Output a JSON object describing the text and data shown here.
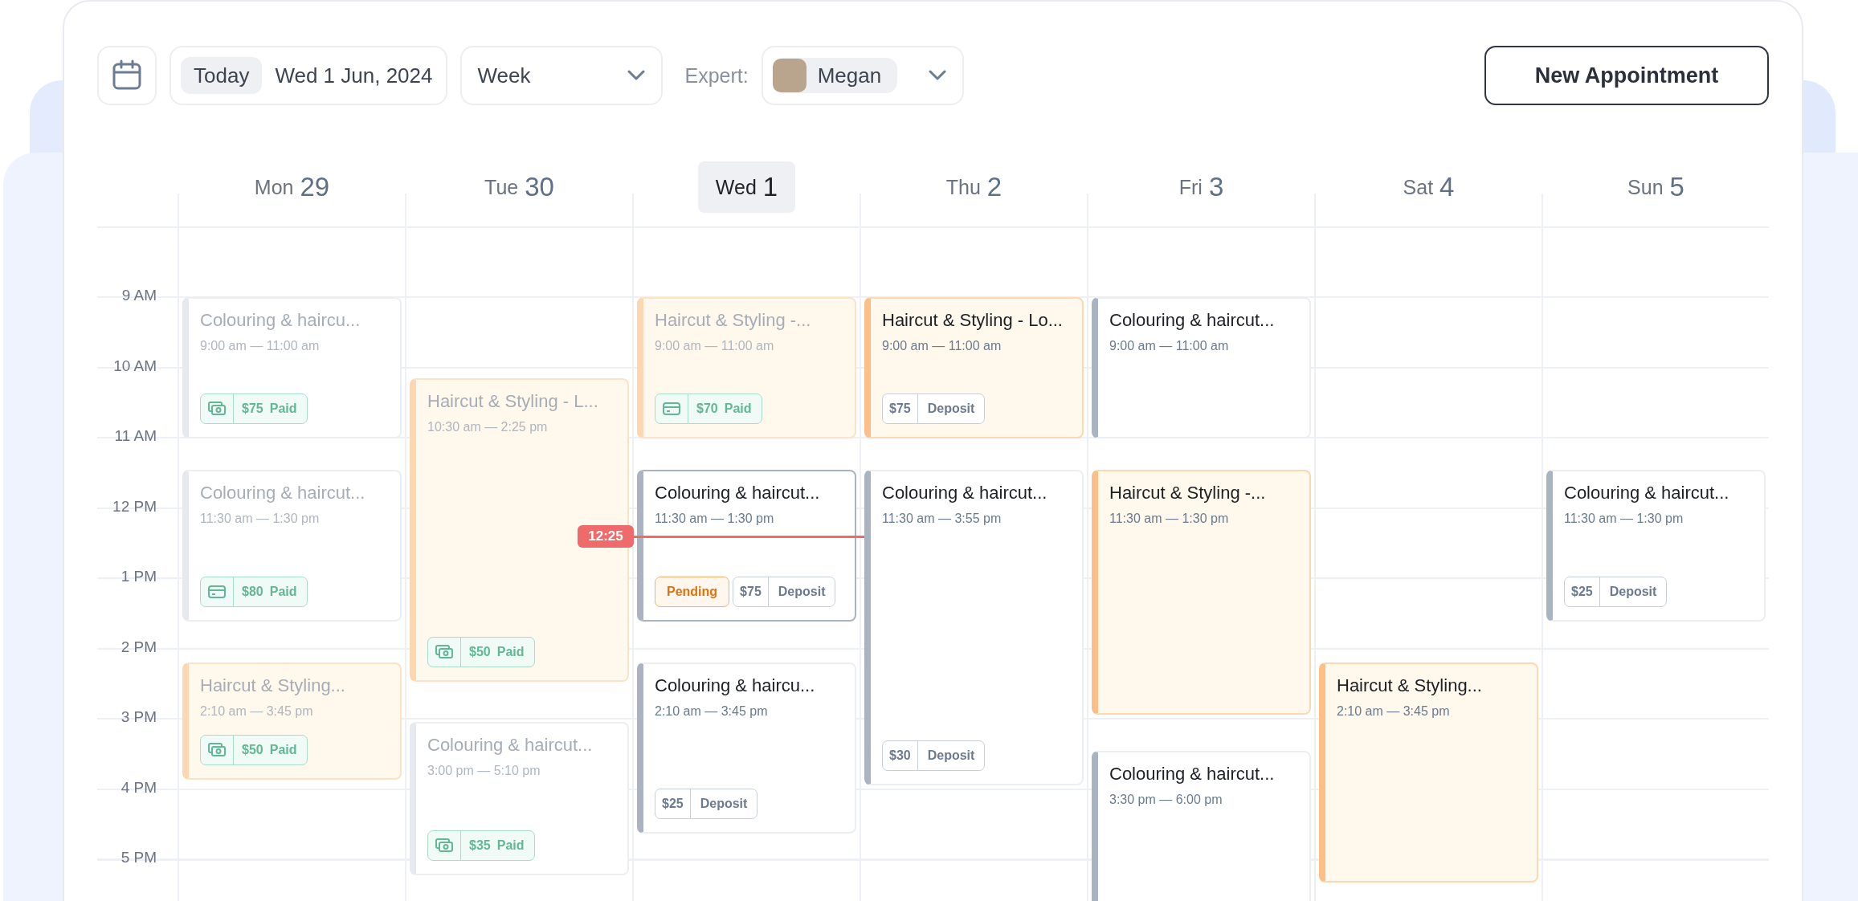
{
  "toolbar": {
    "today_button": "Today",
    "date": "Wed 1 Jun, 2024",
    "view_select": {
      "value": "Week"
    },
    "expert_label": "Expert:",
    "expert_select": {
      "value": "Megan"
    },
    "new_button": "New Appointment"
  },
  "hours": [
    "9 AM",
    "10 AM",
    "11 AM",
    "12 PM",
    "1 PM",
    "2 PM",
    "3 PM",
    "4 PM",
    "5 PM"
  ],
  "days": [
    {
      "weekday": "Mon",
      "date": "29",
      "selected": false,
      "events": [
        {
          "title": "Colouring & haircu...",
          "time": "9:00 am — 11:00 am",
          "kind": "plain",
          "past": true,
          "selected": false,
          "badges": [
            {
              "kind": "paid_cash",
              "amount": "$75",
              "status": "Paid"
            }
          ]
        },
        {
          "title": "Colouring & haircut...",
          "time": "11:30 am — 1:30 pm",
          "kind": "plain",
          "past": true,
          "selected": false,
          "badges": [
            {
              "kind": "paid_card",
              "amount": "$80",
              "status": "Paid"
            }
          ]
        },
        {
          "title": "Haircut & Styling...",
          "time": "2:10 am — 3:45 pm",
          "kind": "warm",
          "past": true,
          "selected": false,
          "badges": [
            {
              "kind": "paid_cash",
              "amount": "$50",
              "status": "Paid"
            }
          ]
        }
      ]
    },
    {
      "weekday": "Tue",
      "date": "30",
      "selected": false,
      "events": [
        {
          "title": "Haircut & Styling - L...",
          "time": "10:30 am — 2:25 pm",
          "kind": "warm",
          "past": true,
          "selected": false,
          "badges": [
            {
              "kind": "paid_cash",
              "amount": "$50",
              "status": "Paid"
            }
          ]
        },
        {
          "title": "Colouring & haircut...",
          "time": "3:00 pm — 5:10 pm",
          "kind": "plain",
          "past": true,
          "selected": false,
          "badges": [
            {
              "kind": "paid_cash",
              "amount": "$35",
              "status": "Paid"
            }
          ]
        }
      ]
    },
    {
      "weekday": "Wed",
      "date": "1",
      "selected": true,
      "now": "12:25",
      "events": [
        {
          "title": "Haircut & Styling -...",
          "time": "9:00 am — 11:00 am",
          "kind": "warm",
          "past": true,
          "selected": false,
          "badges": [
            {
              "kind": "paid_card",
              "amount": "$70",
              "status": "Paid"
            }
          ]
        },
        {
          "title": "Colouring & haircut...",
          "time": "11:30 am — 1:30 pm",
          "kind": "plain",
          "past": false,
          "selected": true,
          "badges": [
            {
              "kind": "pending",
              "label": "Pending"
            },
            {
              "kind": "deposit",
              "amount": "$75",
              "status": "Deposit"
            }
          ]
        },
        {
          "title": "Colouring & haircu...",
          "time": "2:10 am — 3:45 pm",
          "kind": "plain",
          "past": false,
          "selected": false,
          "badges": [
            {
              "kind": "deposit",
              "amount": "$25",
              "status": "Deposit"
            }
          ]
        }
      ]
    },
    {
      "weekday": "Thu",
      "date": "2",
      "selected": false,
      "events": [
        {
          "title": "Haircut & Styling - Lo...",
          "time": "9:00 am — 11:00 am",
          "kind": "warm",
          "past": false,
          "selected": false,
          "badges": [
            {
              "kind": "deposit",
              "amount": "$75",
              "status": "Deposit"
            }
          ]
        },
        {
          "title": "Colouring & haircut...",
          "time": "11:30 am — 3:55 pm",
          "kind": "plain",
          "past": false,
          "selected": false,
          "badges": [
            {
              "kind": "deposit",
              "amount": "$30",
              "status": "Deposit"
            }
          ]
        }
      ]
    },
    {
      "weekday": "Fri",
      "date": "3",
      "selected": false,
      "events": [
        {
          "title": "Colouring & haircut...",
          "time": "9:00 am — 11:00 am",
          "kind": "plain",
          "past": false,
          "selected": false
        },
        {
          "title": "Haircut & Styling -...",
          "time": "11:30 am — 1:30 pm",
          "kind": "warm",
          "past": false,
          "selected": false
        },
        {
          "title": "Colouring & haircut...",
          "time": "3:30 pm — 6:00 pm",
          "kind": "plain",
          "past": false,
          "selected": false
        }
      ]
    },
    {
      "weekday": "Sat",
      "date": "4",
      "selected": false,
      "events": [
        {
          "title": "Haircut & Styling...",
          "time": "2:10 am — 3:45 pm",
          "kind": "warm",
          "past": false,
          "selected": false
        }
      ]
    },
    {
      "weekday": "Sun",
      "date": "5",
      "selected": false,
      "events": [
        {
          "title": "Colouring & haircut...",
          "time": "11:30 am — 1:30 pm",
          "kind": "plain",
          "past": false,
          "selected": false,
          "badges": [
            {
              "kind": "deposit",
              "amount": "$25",
              "status": "Deposit"
            }
          ]
        }
      ]
    }
  ]
}
